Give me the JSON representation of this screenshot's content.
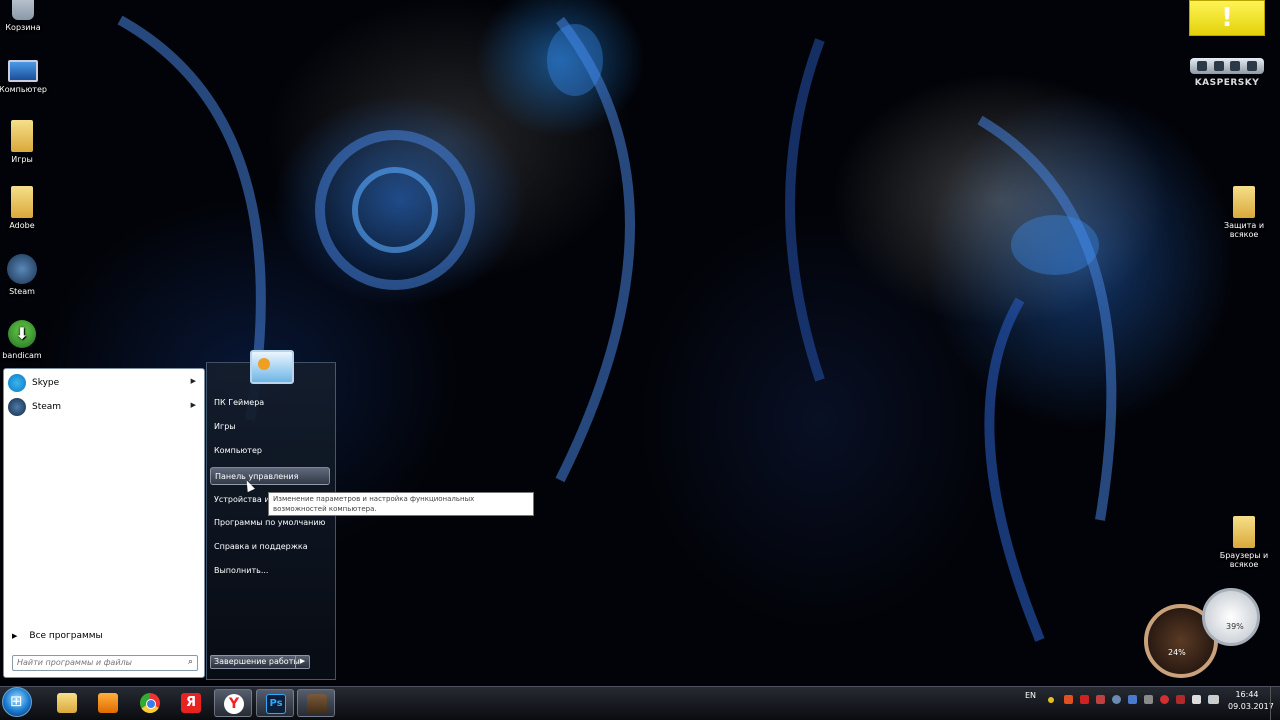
{
  "desktop": {
    "icons_left": [
      {
        "label": "Корзина",
        "icon": "recycle-bin-icon"
      },
      {
        "label": "Компьютер",
        "icon": "computer-icon"
      },
      {
        "label": "Игры",
        "icon": "folder-icon"
      },
      {
        "label": "Adobe",
        "icon": "folder-icon"
      },
      {
        "label": "Steam",
        "icon": "steam-icon"
      },
      {
        "label": "bandicam",
        "icon": "bandicam-icon"
      }
    ],
    "icons_right": [
      {
        "label": "Защита и всякое",
        "icon": "folder-icon"
      },
      {
        "label": "Браузеры и всякое",
        "icon": "folder-icon"
      }
    ]
  },
  "kaspersky_gadget": {
    "alert_symbol": "!",
    "brand": "KASPERSKY"
  },
  "clock_gadget": {
    "value_1": "24%",
    "value_2": "39%"
  },
  "start_menu": {
    "pinned_programs": [
      {
        "label": "Skype",
        "icon": "skype-icon"
      },
      {
        "label": "Steam",
        "icon": "steam-icon"
      }
    ],
    "all_programs_label": "Все программы",
    "search_placeholder": "Найти программы и файлы",
    "right_items": [
      "ПК Геймера",
      "Игры",
      "Компьютер",
      "Панель управления",
      "Устройства и п",
      "Программы по умолчанию",
      "Справка и поддержка",
      "Выполнить..."
    ],
    "highlighted_item": "Панель управления",
    "tooltip": "Изменение параметров и настройка функциональных возможностей компьютера.",
    "shutdown_label": "Завершение работы"
  },
  "taskbar": {
    "pinned": [
      {
        "name": "explorer",
        "icon": "folder-icon"
      },
      {
        "name": "media-player",
        "icon": "media-player-icon"
      },
      {
        "name": "chrome",
        "icon": "chrome-icon"
      },
      {
        "name": "yandex",
        "icon": "yandex-icon",
        "glyph": "Я"
      },
      {
        "name": "yandex-browser",
        "icon": "yandex-browser-icon",
        "glyph": "Y"
      },
      {
        "name": "photoshop",
        "icon": "photoshop-icon",
        "glyph": "Ps"
      },
      {
        "name": "minecraft",
        "icon": "minecraft-icon"
      }
    ],
    "language": "EN",
    "time": "16:44",
    "date": "09.03.2017"
  }
}
